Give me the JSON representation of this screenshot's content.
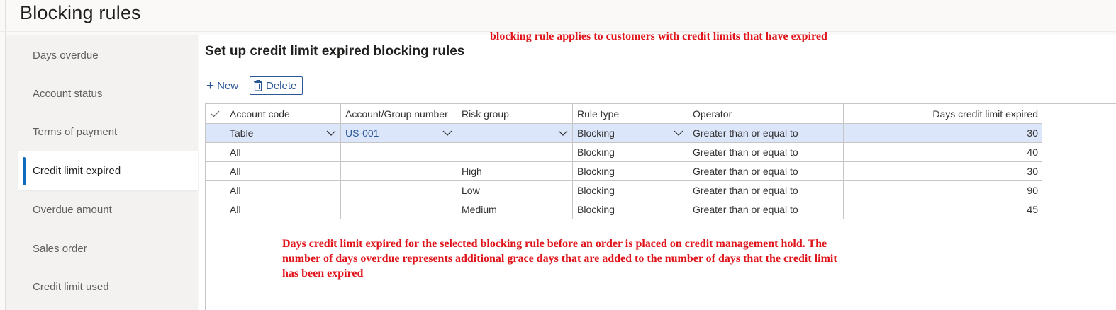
{
  "page_title": "Blocking rules",
  "sidebar": {
    "items": [
      {
        "label": "Days overdue",
        "selected": false
      },
      {
        "label": "Account status",
        "selected": false
      },
      {
        "label": "Terms of payment",
        "selected": false
      },
      {
        "label": "Credit limit expired",
        "selected": true
      },
      {
        "label": "Overdue amount",
        "selected": false
      },
      {
        "label": "Sales order",
        "selected": false
      },
      {
        "label": "Credit limit used",
        "selected": false
      }
    ]
  },
  "panel": {
    "title": "Set up credit limit expired blocking rules"
  },
  "toolbar": {
    "new_label": "New",
    "delete_label": "Delete",
    "new_icon": "plus-icon",
    "delete_icon": "trash-icon"
  },
  "annotations": {
    "top": "blocking rule applies to customers with credit limits that have expired",
    "bottom_lines": [
      "Days credit limit expired for the selected blocking rule before an order is placed on credit management hold. The",
      "number of days overdue represents additional grace days that are added to the number of days that the credit limit",
      "has been expired"
    ]
  },
  "grid": {
    "columns": [
      "Account code",
      "Account/Group number",
      "Risk group",
      "Rule type",
      "Operator",
      "Days credit limit expired"
    ],
    "rows": [
      {
        "account_code": "Table",
        "account_group_number": "US-001",
        "risk_group": "",
        "rule_type": "Blocking",
        "operator": "Greater than or equal to",
        "days": "30",
        "selected": true
      },
      {
        "account_code": "All",
        "account_group_number": "",
        "risk_group": "",
        "rule_type": "Blocking",
        "operator": "Greater than or equal to",
        "days": "40",
        "selected": false
      },
      {
        "account_code": "All",
        "account_group_number": "",
        "risk_group": "High",
        "rule_type": "Blocking",
        "operator": "Greater than or equal to",
        "days": "30",
        "selected": false
      },
      {
        "account_code": "All",
        "account_group_number": "",
        "risk_group": "Low",
        "rule_type": "Blocking",
        "operator": "Greater than or equal to",
        "days": "90",
        "selected": false
      },
      {
        "account_code": "All",
        "account_group_number": "",
        "risk_group": "Medium",
        "rule_type": "Blocking",
        "operator": "Greater than or equal to",
        "days": "45",
        "selected": false
      }
    ]
  },
  "colors": {
    "accent": "#0f6cbd",
    "selected_row": "#dce6fa",
    "annotation": "#e0141a",
    "button_text": "#2b5797"
  }
}
